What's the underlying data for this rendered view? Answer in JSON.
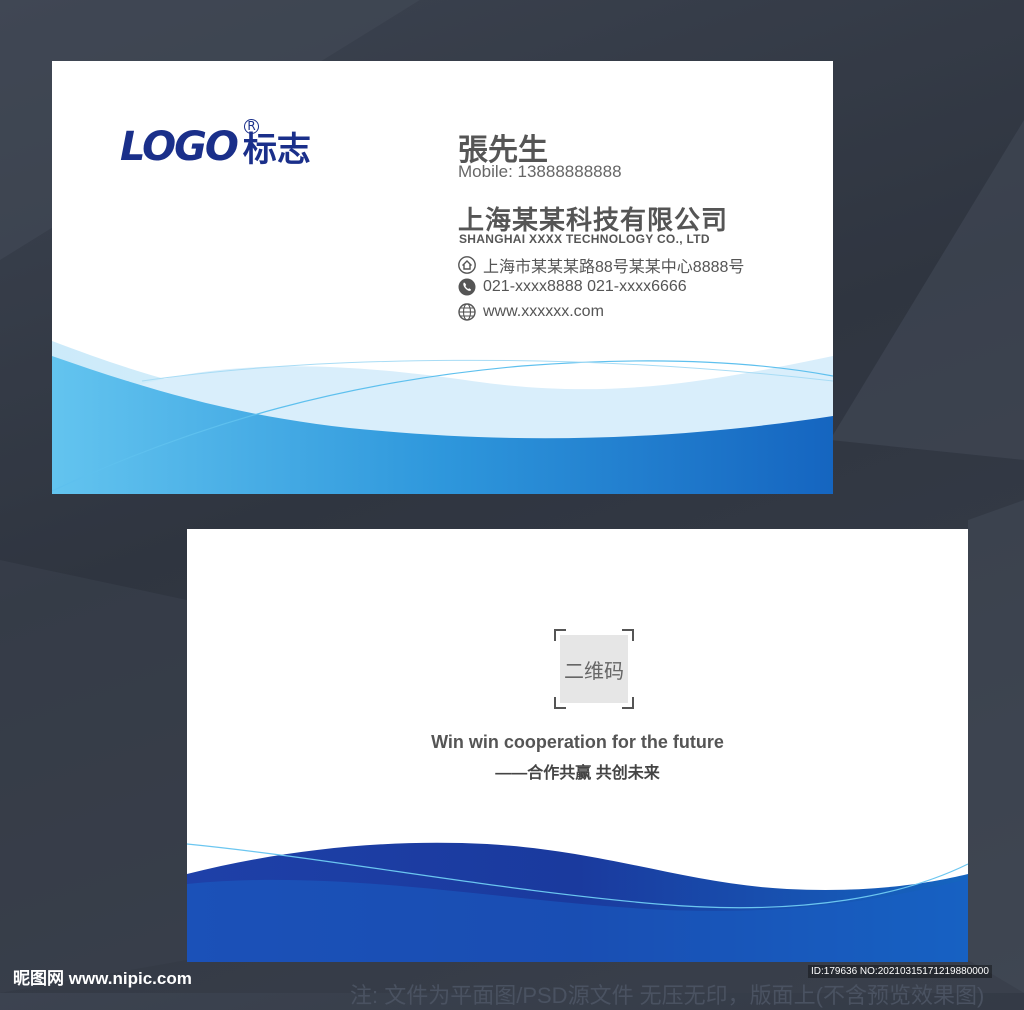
{
  "front": {
    "logo_latin": "LOGO",
    "logo_registered": "R",
    "logo_cjk": "标志",
    "name": "張先生",
    "mobile": "Mobile: 13888888888",
    "company": "上海某某科技有限公司",
    "company_en": "SHANGHAI XXXX TECHNOLOGY CO., LTD",
    "address": "上海市某某某路88号某某中心8888号",
    "phone": "021-xxxx8888  021-xxxx6666",
    "website": "www.xxxxxx.com",
    "icons": [
      "home-icon",
      "phone-icon",
      "globe-icon"
    ]
  },
  "back": {
    "qr_placeholder": "二维码",
    "tagline_en": "Win win cooperation for the future",
    "tagline_cn": "——合作共赢 共创未来"
  },
  "watermark": {
    "site": "昵图网 www.nipic.com",
    "bottom_text": "注: 文件为平面图/PSD源文件  无压无印，版面上(不含预览效果图)",
    "id_text": "ID:179636 NO:20210315171219880000"
  },
  "colors": {
    "logo_blue": "#1a2f8a",
    "wave_light": "#5ab4e8",
    "wave_dark": "#1565c0",
    "text_gray": "#555555"
  }
}
